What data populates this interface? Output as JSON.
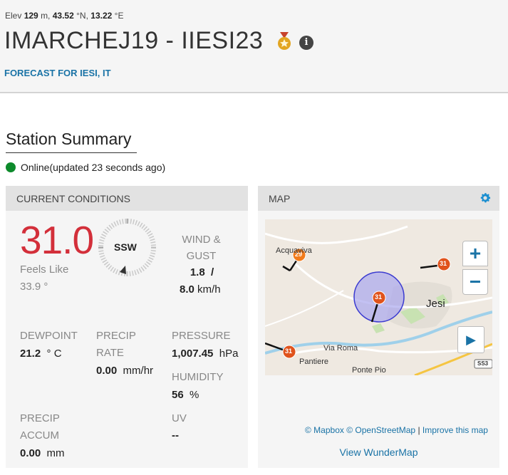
{
  "header": {
    "elev_label": "Elev",
    "elev_value": "129",
    "elev_unit": "m,",
    "lat_value": "43.52",
    "lat_unit": "°N,",
    "lon_value": "13.22",
    "lon_unit": "°E",
    "title": "IMARCHEJ19 - IIESI23",
    "forecast_link": "FORECAST FOR IESI, IT"
  },
  "summary": {
    "heading": "Station Summary",
    "status_text": "Online(updated 23 seconds ago)",
    "status_color": "#0d8a2b"
  },
  "current": {
    "header": "CURRENT CONDITIONS",
    "temperature": "31.0",
    "feels_like_label": "Feels Like",
    "feels_like_value": "33.9 °",
    "wind_dir": "SSW",
    "wind_label_1": "WIND &",
    "wind_label_2": "GUST",
    "wind_speed": "1.8",
    "wind_sep": "/",
    "gust_speed": "8.0",
    "wind_unit": "km/h",
    "dewpoint_label": "DEWPOINT",
    "dewpoint_value": "21.2",
    "dewpoint_unit": "° C",
    "precip_rate_label_1": "PRECIP",
    "precip_rate_label_2": "RATE",
    "precip_rate_value": "0.00",
    "precip_rate_unit": "mm/hr",
    "pressure_label": "PRESSURE",
    "pressure_value": "1,007.45",
    "pressure_unit": "hPa",
    "humidity_label": "HUMIDITY",
    "humidity_value": "56",
    "humidity_unit": "%",
    "precip_accum_label_1": "PRECIP",
    "precip_accum_label_2": "ACCUM",
    "precip_accum_value": "0.00",
    "precip_accum_unit": "mm",
    "uv_label": "UV",
    "uv_value": "--",
    "temp_color": "#d32f3a"
  },
  "map_card": {
    "header": "MAP",
    "settings_icon": "gear-icon",
    "labels": {
      "acquaviva": "Acquaviva",
      "jesi": "Jesi",
      "via_roma": "Via Roma",
      "pantiere": "Pantiere",
      "ponte_pio": "Ponte Pio",
      "road": "SS3"
    },
    "markers": [
      "29",
      "31",
      "31",
      "31"
    ],
    "zoom_in": "+",
    "zoom_out": "−",
    "play": "▶",
    "attribution_mapbox": "© Mapbox",
    "attribution_osm": "© OpenStreetMap",
    "attribution_sep": "|",
    "attribution_improve": "Improve this map",
    "view_link": "View WunderMap"
  }
}
